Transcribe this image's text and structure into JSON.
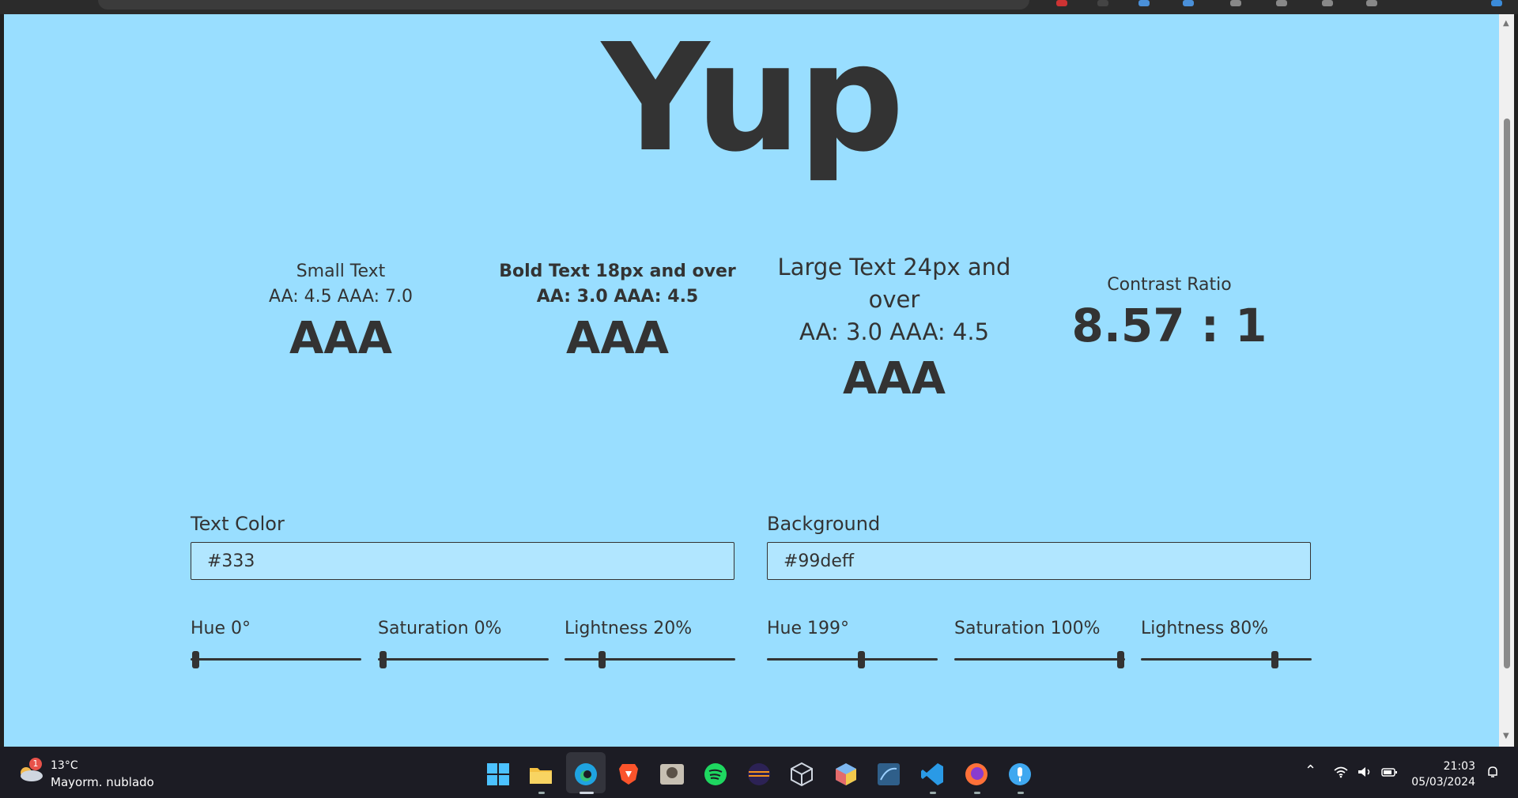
{
  "page": {
    "hero_text": "Yup",
    "colors": {
      "background": "#99deff",
      "text": "#333"
    }
  },
  "metrics": {
    "small": {
      "title": "Small Text",
      "thresholds": "AA: 4.5 AAA: 7.0",
      "rating": "AAA"
    },
    "bold": {
      "title": "Bold Text 18px and over",
      "thresholds": "AA: 3.0 AAA: 4.5",
      "rating": "AAA"
    },
    "large": {
      "title": "Large Text 24px and over",
      "thresholds": "AA: 3.0 AAA: 4.5",
      "rating": "AAA"
    },
    "contrast": {
      "title": "Contrast Ratio",
      "value": "8.57 : 1"
    }
  },
  "text_color": {
    "label": "Text Color",
    "value": "#333",
    "hue": {
      "label": "Hue 0°",
      "value": 0,
      "max": 360
    },
    "saturation": {
      "label": "Saturation 0%",
      "value": 0,
      "max": 100
    },
    "lightness": {
      "label": "Lightness 20%",
      "value": 20,
      "max": 100
    }
  },
  "background_color": {
    "label": "Background",
    "value": "#99deff",
    "hue": {
      "label": "Hue 199°",
      "value": 199,
      "max": 360
    },
    "saturation": {
      "label": "Saturation 100%",
      "value": 100,
      "max": 100
    },
    "lightness": {
      "label": "Lightness 80%",
      "value": 80,
      "max": 100
    }
  },
  "taskbar": {
    "weather_badge": "1",
    "weather_temp": "13°C",
    "weather_desc": "Mayorm. nublado",
    "time": "21:03",
    "date": "05/03/2024",
    "apps": [
      "start-icon",
      "file-explorer-icon",
      "edge-icon",
      "brave-icon",
      "photo-app-icon",
      "spotify-icon",
      "eclipse-icon",
      "virtualbox-icon",
      "box-app-icon",
      "mysql-workbench-icon",
      "vscode-icon",
      "firefox-icon",
      "microphone-app-icon"
    ]
  }
}
